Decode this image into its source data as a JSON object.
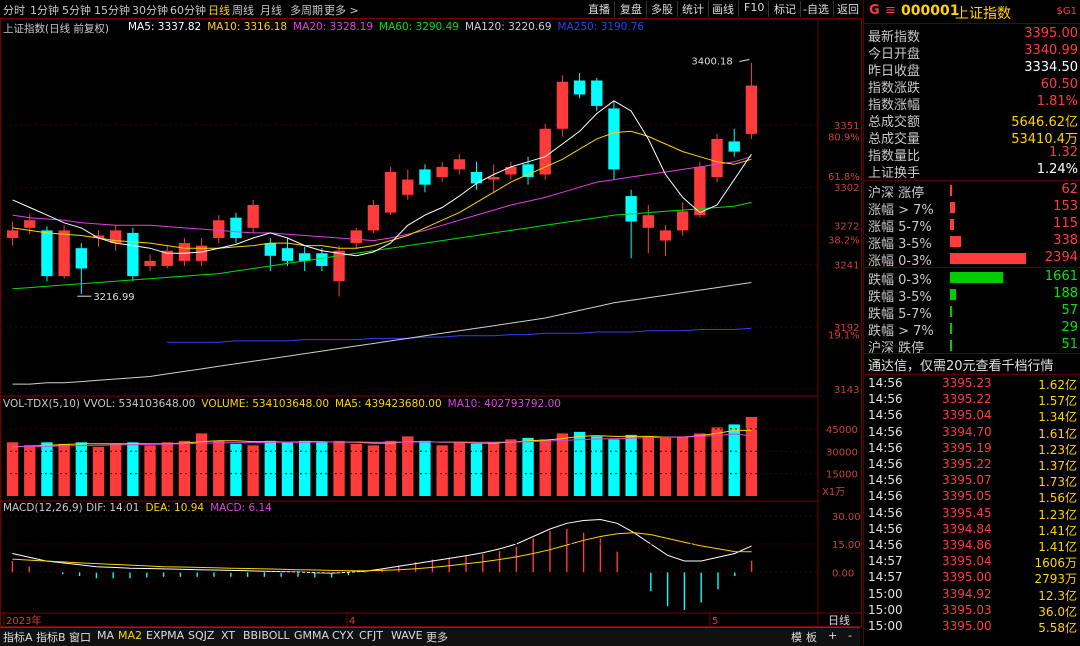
{
  "toolbar": {
    "items": [
      "分时",
      "1分钟",
      "5分钟",
      "15分钟",
      "30分钟",
      "60分钟",
      "日线",
      "周线",
      "月线",
      "多周期",
      "更多 >"
    ],
    "active_index": 6,
    "right_items": [
      "直播",
      "复盘",
      "多股",
      "统计",
      "画线",
      "F10",
      "标记",
      "-自选",
      "返回"
    ]
  },
  "chart": {
    "title": "上证指数(日线 前复权)",
    "ma_legend": [
      {
        "text": "MA5: 3337.82",
        "color": "#ffffff"
      },
      {
        "text": "MA10: 3316.18",
        "color": "#ffd200"
      },
      {
        "text": "MA20: 3328.19",
        "color": "#e040e0"
      },
      {
        "text": "MA60: 3290.49",
        "color": "#00e000"
      },
      {
        "text": "MA120: 3220.69",
        "color": "#cfcfcf"
      },
      {
        "text": "MA250: 3190.76",
        "color": "#3040ff"
      }
    ],
    "high_label": "3400.18",
    "low_label": "3216.99",
    "price_axis": [
      "3351",
      "3302",
      "3272",
      "3241",
      "3192",
      "3143"
    ],
    "pct_axis": [
      "80.9%",
      "61.8%",
      "38.2%",
      "19.1%"
    ],
    "vol_legend": [
      {
        "text": "VOL-TDX(5,10) VVOL: 534103648.00",
        "color": "#c8c8c8"
      },
      {
        "text": "VOLUME: 534103648.00",
        "color": "#ffd200"
      },
      {
        "text": "MA5: 439423680.00",
        "color": "#ffd200"
      },
      {
        "text": "MA10: 402793792.00",
        "color": "#e040e0"
      }
    ],
    "vol_axis": [
      "45000",
      "30000",
      "15000",
      "X1万"
    ],
    "macd_legend": [
      {
        "text": "MACD(12,26,9) DIF: 14.01",
        "color": "#c8c8c8"
      },
      {
        "text": "DEA: 10.94",
        "color": "#ffd200"
      },
      {
        "text": "MACD: 6.14",
        "color": "#e040e0"
      }
    ],
    "macd_axis": [
      "30.00",
      "15.00",
      "0.00"
    ],
    "date_labels": [
      "2023年",
      "4",
      "5"
    ],
    "date_right": "日线"
  },
  "bottom_tabs": {
    "items": [
      "指标A",
      "指标B",
      "窗口",
      "MA",
      "MA2",
      "EXPMA",
      "SQJZ",
      "XT",
      "BBIBOLL",
      "GMMA",
      "CYX",
      "CFJT",
      "WAVE",
      "更多"
    ],
    "active_index": 4,
    "right": [
      "模",
      "板",
      "+",
      "-"
    ]
  },
  "quote": {
    "badge": "G",
    "icon": "menu-icon",
    "code": "000001",
    "name": "上证指数",
    "tag": "$G1",
    "rows": [
      {
        "label": "最新指数",
        "value": "3395.00",
        "cls": "red"
      },
      {
        "label": "今日开盘",
        "value": "3340.99",
        "cls": "red"
      },
      {
        "label": "昨日收盘",
        "value": "3334.50",
        "cls": "white"
      },
      {
        "label": "指数涨跌",
        "value": "60.50",
        "cls": "red"
      },
      {
        "label": "指数涨幅",
        "value": "1.81%",
        "cls": "red"
      },
      {
        "label": "总成交额",
        "value": "5646.62亿",
        "cls": "yellow"
      },
      {
        "label": "总成交量",
        "value": "53410.4万",
        "cls": "yellow"
      },
      {
        "label": "指数量比",
        "value": "1.32",
        "cls": "red"
      },
      {
        "label": "上证换手",
        "value": "1.24%",
        "cls": "white"
      }
    ],
    "breadth_up": [
      {
        "label": "沪深 涨停",
        "value": "62",
        "frac": 0.026
      },
      {
        "label": "涨幅 > 7%",
        "value": "153",
        "frac": 0.064
      },
      {
        "label": "涨幅 5-7%",
        "value": "115",
        "frac": 0.048
      },
      {
        "label": "涨幅 3-5%",
        "value": "338",
        "frac": 0.141
      },
      {
        "label": "涨幅 0-3%",
        "value": "2394",
        "frac": 1.0
      }
    ],
    "breadth_down": [
      {
        "label": "跌幅 0-3%",
        "value": "1661",
        "frac": 0.694
      },
      {
        "label": "跌幅 3-5%",
        "value": "188",
        "frac": 0.079
      },
      {
        "label": "跌幅 5-7%",
        "value": "57",
        "frac": 0.024
      },
      {
        "label": "跌幅 > 7%",
        "value": "29",
        "frac": 0.012
      },
      {
        "label": "沪深 跌停",
        "value": "51",
        "frac": 0.021
      }
    ],
    "promo": "通达信，仅需20元查看千档行情",
    "ticks": [
      {
        "time": "14:56",
        "price": "3395.23",
        "vol": "1.62亿"
      },
      {
        "time": "14:56",
        "price": "3395.22",
        "vol": "1.57亿"
      },
      {
        "time": "14:56",
        "price": "3395.04",
        "vol": "1.34亿"
      },
      {
        "time": "14:56",
        "price": "3394.70",
        "vol": "1.61亿"
      },
      {
        "time": "14:56",
        "price": "3395.19",
        "vol": "1.23亿"
      },
      {
        "time": "14:56",
        "price": "3395.22",
        "vol": "1.37亿"
      },
      {
        "time": "14:56",
        "price": "3395.07",
        "vol": "1.73亿"
      },
      {
        "time": "14:56",
        "price": "3395.05",
        "vol": "1.56亿"
      },
      {
        "time": "14:56",
        "price": "3395.45",
        "vol": "1.23亿"
      },
      {
        "time": "14:56",
        "price": "3394.84",
        "vol": "1.41亿"
      },
      {
        "time": "14:56",
        "price": "3394.86",
        "vol": "1.41亿"
      },
      {
        "time": "14:57",
        "price": "3395.04",
        "vol": "1606万"
      },
      {
        "time": "14:57",
        "price": "3395.00",
        "vol": "2793万"
      },
      {
        "time": "15:00",
        "price": "3394.92",
        "vol": "12.3亿"
      },
      {
        "time": "15:00",
        "price": "3395.03",
        "vol": "36.0亿"
      },
      {
        "time": "15:00",
        "price": "3395.00",
        "vol": "5.58亿"
      }
    ]
  },
  "chart_data": {
    "type": "candlestick",
    "title": "上证指数(日线 前复权)",
    "candles": [
      [
        3262,
        3268,
        3256,
        3275
      ],
      [
        3270,
        3276,
        3265,
        3281
      ],
      [
        3268,
        3232,
        3228,
        3271
      ],
      [
        3232,
        3268,
        3230,
        3272
      ],
      [
        3254,
        3238,
        3218,
        3258
      ],
      [
        3262,
        3264,
        3255,
        3268
      ],
      [
        3258,
        3268,
        3252,
        3272
      ],
      [
        3266,
        3232,
        3228,
        3270
      ],
      [
        3240,
        3244,
        3236,
        3249
      ],
      [
        3240,
        3252,
        3238,
        3256
      ],
      [
        3244,
        3258,
        3240,
        3262
      ],
      [
        3244,
        3256,
        3240,
        3262
      ],
      [
        3262,
        3276,
        3258,
        3280
      ],
      [
        3278,
        3262,
        3258,
        3282
      ],
      [
        3270,
        3288,
        3266,
        3292
      ],
      [
        3258,
        3248,
        3236,
        3262
      ],
      [
        3254,
        3244,
        3240,
        3262
      ],
      [
        3250,
        3244,
        3236,
        3255
      ],
      [
        3250,
        3240,
        3236,
        3254
      ],
      [
        3228,
        3252,
        3216,
        3256
      ],
      [
        3258,
        3268,
        3254,
        3270
      ],
      [
        3268,
        3288,
        3266,
        3292
      ],
      [
        3282,
        3314,
        3280,
        3318
      ],
      [
        3296,
        3308,
        3292,
        3316
      ],
      [
        3316,
        3304,
        3298,
        3320
      ],
      [
        3310,
        3318,
        3306,
        3322
      ],
      [
        3316,
        3324,
        3312,
        3328
      ],
      [
        3314,
        3305,
        3300,
        3322
      ],
      [
        3308,
        3310,
        3298,
        3320
      ],
      [
        3312,
        3318,
        3308,
        3322
      ],
      [
        3320,
        3310,
        3304,
        3326
      ],
      [
        3312,
        3348,
        3308,
        3352
      ],
      [
        3348,
        3385,
        3342,
        3390
      ],
      [
        3386,
        3375,
        3372,
        3392
      ],
      [
        3386,
        3366,
        3362,
        3388
      ],
      [
        3364,
        3316,
        3308,
        3370
      ],
      [
        3295,
        3275,
        3246,
        3300
      ],
      [
        3270,
        3280,
        3250,
        3288
      ],
      [
        3260,
        3268,
        3248,
        3272
      ],
      [
        3268,
        3283,
        3264,
        3290
      ],
      [
        3280,
        3318,
        3278,
        3322
      ],
      [
        3310,
        3340,
        3306,
        3344
      ],
      [
        3338,
        3330,
        3326,
        3348
      ],
      [
        3344,
        3382,
        3340,
        3400
      ]
    ],
    "ma5": [
      3292,
      3286,
      3280,
      3274,
      3270,
      3262,
      3258,
      3256,
      3254,
      3250,
      3250,
      3251,
      3254,
      3257,
      3262,
      3266,
      3262,
      3256,
      3252,
      3250,
      3248,
      3251,
      3258,
      3272,
      3280,
      3286,
      3295,
      3305,
      3312,
      3318,
      3322,
      3326,
      3336,
      3346,
      3360,
      3370,
      3362,
      3340,
      3312,
      3294,
      3282,
      3288,
      3308,
      3328
    ],
    "ma10": [
      3270,
      3268,
      3266,
      3265,
      3264,
      3262,
      3260,
      3259,
      3258,
      3256,
      3254,
      3254,
      3254,
      3255,
      3256,
      3258,
      3258,
      3256,
      3256,
      3254,
      3254,
      3256,
      3260,
      3264,
      3270,
      3276,
      3282,
      3290,
      3298,
      3306,
      3312,
      3318,
      3324,
      3332,
      3340,
      3345,
      3346,
      3342,
      3336,
      3330,
      3326,
      3322,
      3320,
      3324
    ],
    "ma20": [
      3280,
      3278,
      3277,
      3276,
      3274,
      3273,
      3272,
      3272,
      3272,
      3271,
      3270,
      3269,
      3268,
      3267,
      3266,
      3266,
      3265,
      3264,
      3263,
      3262,
      3261,
      3260,
      3262,
      3265,
      3268,
      3272,
      3276,
      3280,
      3284,
      3288,
      3291,
      3294,
      3298,
      3302,
      3306,
      3308,
      3310,
      3312,
      3314,
      3316,
      3318,
      3320,
      3322,
      3326
    ],
    "ma60": [
      3222,
      3223,
      3224,
      3225,
      3226,
      3227,
      3228,
      3229,
      3230,
      3231,
      3232,
      3233,
      3234,
      3236,
      3238,
      3240,
      3242,
      3244,
      3246,
      3248,
      3250,
      3252,
      3254,
      3256,
      3258,
      3260,
      3262,
      3264,
      3266,
      3268,
      3270,
      3272,
      3274,
      3276,
      3278,
      3280,
      3281,
      3282,
      3283,
      3284,
      3285,
      3286,
      3287,
      3290
    ],
    "ma120": [
      3147,
      3147,
      3148,
      3148,
      3149,
      3150,
      3151,
      3152,
      3153,
      3155,
      3157,
      3159,
      3161,
      3163,
      3165,
      3167,
      3169,
      3171,
      3173,
      3175,
      3177,
      3179,
      3181,
      3183,
      3185,
      3187,
      3189,
      3191,
      3193,
      3195,
      3197,
      3199,
      3202,
      3205,
      3208,
      3211,
      3213,
      3215,
      3217,
      3219,
      3221,
      3223,
      3225,
      3227
    ],
    "ma250": [
      null,
      null,
      null,
      null,
      null,
      null,
      null,
      null,
      null,
      3180,
      3180,
      3180,
      3180,
      3181,
      3181,
      3181,
      3181,
      3182,
      3182,
      3182,
      3182,
      3183,
      3183,
      3183,
      3184,
      3184,
      3185,
      3185,
      3185,
      3186,
      3186,
      3187,
      3187,
      3187,
      3188,
      3188,
      3188,
      3189,
      3189,
      3189,
      3190,
      3190,
      3190,
      3191
    ],
    "volume": [
      36000,
      34000,
      36000,
      35000,
      36000,
      33000,
      35000,
      36000,
      34000,
      36000,
      37000,
      42000,
      37000,
      35000,
      34000,
      37000,
      36000,
      37000,
      36000,
      37000,
      35000,
      34000,
      37000,
      40000,
      37000,
      34000,
      36000,
      35000,
      36000,
      38000,
      39000,
      38000,
      42000,
      43000,
      40000,
      38000,
      41000,
      40000,
      39000,
      40000,
      42000,
      46000,
      48000,
      53000
    ],
    "vol_ma5": [
      33000,
      33500,
      34000,
      34500,
      35000,
      35000,
      35000,
      35000,
      35000,
      35000,
      35500,
      36500,
      37000,
      37000,
      36500,
      36500,
      36000,
      36500,
      36500,
      36000,
      36000,
      35500,
      35500,
      36500,
      36500,
      36000,
      36000,
      35500,
      35500,
      36000,
      37000,
      37500,
      38500,
      40000,
      40500,
      40000,
      40000,
      40000,
      39500,
      39500,
      40500,
      42000,
      44000,
      44000
    ],
    "vol_ma10": [
      33000,
      33200,
      33400,
      33600,
      33800,
      34000,
      34200,
      34400,
      34600,
      34800,
      35000,
      35400,
      35600,
      35800,
      35800,
      36000,
      36000,
      36000,
      36200,
      36200,
      36200,
      36000,
      36000,
      36200,
      36200,
      36200,
      36200,
      36000,
      36000,
      36200,
      36400,
      36800,
      37200,
      37800,
      38200,
      38400,
      38800,
      39200,
      39400,
      39600,
      40000,
      40600,
      41600,
      40280
    ],
    "dif": [
      10,
      8,
      6,
      5,
      4,
      3,
      2.6,
      2.2,
      2,
      1.8,
      1.6,
      1.4,
      1.2,
      1.0,
      0.8,
      0.6,
      0.4,
      0.2,
      -0.2,
      -0.4,
      0,
      0.6,
      1.8,
      3.2,
      4.6,
      6,
      7.4,
      8.8,
      10.4,
      12.4,
      15,
      19,
      23,
      26,
      27.5,
      28,
      26,
      21,
      15,
      9,
      6,
      6,
      8,
      10,
      14
    ],
    "dea": [
      7,
      6.5,
      6,
      5.5,
      5,
      4.6,
      4.2,
      3.8,
      3.4,
      3.0,
      2.8,
      2.6,
      2.4,
      2.2,
      2.0,
      1.8,
      1.6,
      1.4,
      1.2,
      1.0,
      0.8,
      0.8,
      1.0,
      1.4,
      1.9,
      2.6,
      3.5,
      4.5,
      5.5,
      6.8,
      8.2,
      10,
      12,
      14.5,
      17,
      19,
      20.5,
      21,
      20,
      18,
      16,
      14,
      12.5,
      11,
      10.94
    ],
    "macd": [
      6,
      3,
      0,
      -1,
      -2,
      -3.2,
      -3.2,
      -3.2,
      -2.8,
      -2.4,
      -2.4,
      -2.4,
      -2.4,
      -2.4,
      -2.4,
      -2.4,
      -2.4,
      -2.4,
      -2.8,
      -2.8,
      -1.6,
      -0.4,
      1.6,
      3.6,
      5.4,
      6.8,
      7.8,
      8.6,
      9.8,
      11.2,
      13.6,
      18,
      22,
      23,
      21,
      18,
      11,
      0,
      -10,
      -18,
      -20,
      -16,
      -9,
      -2,
      6.14
    ],
    "price_range": [
      3140,
      3410
    ],
    "vol_range": [
      0,
      55000
    ],
    "macd_range": [
      -20,
      32
    ]
  }
}
